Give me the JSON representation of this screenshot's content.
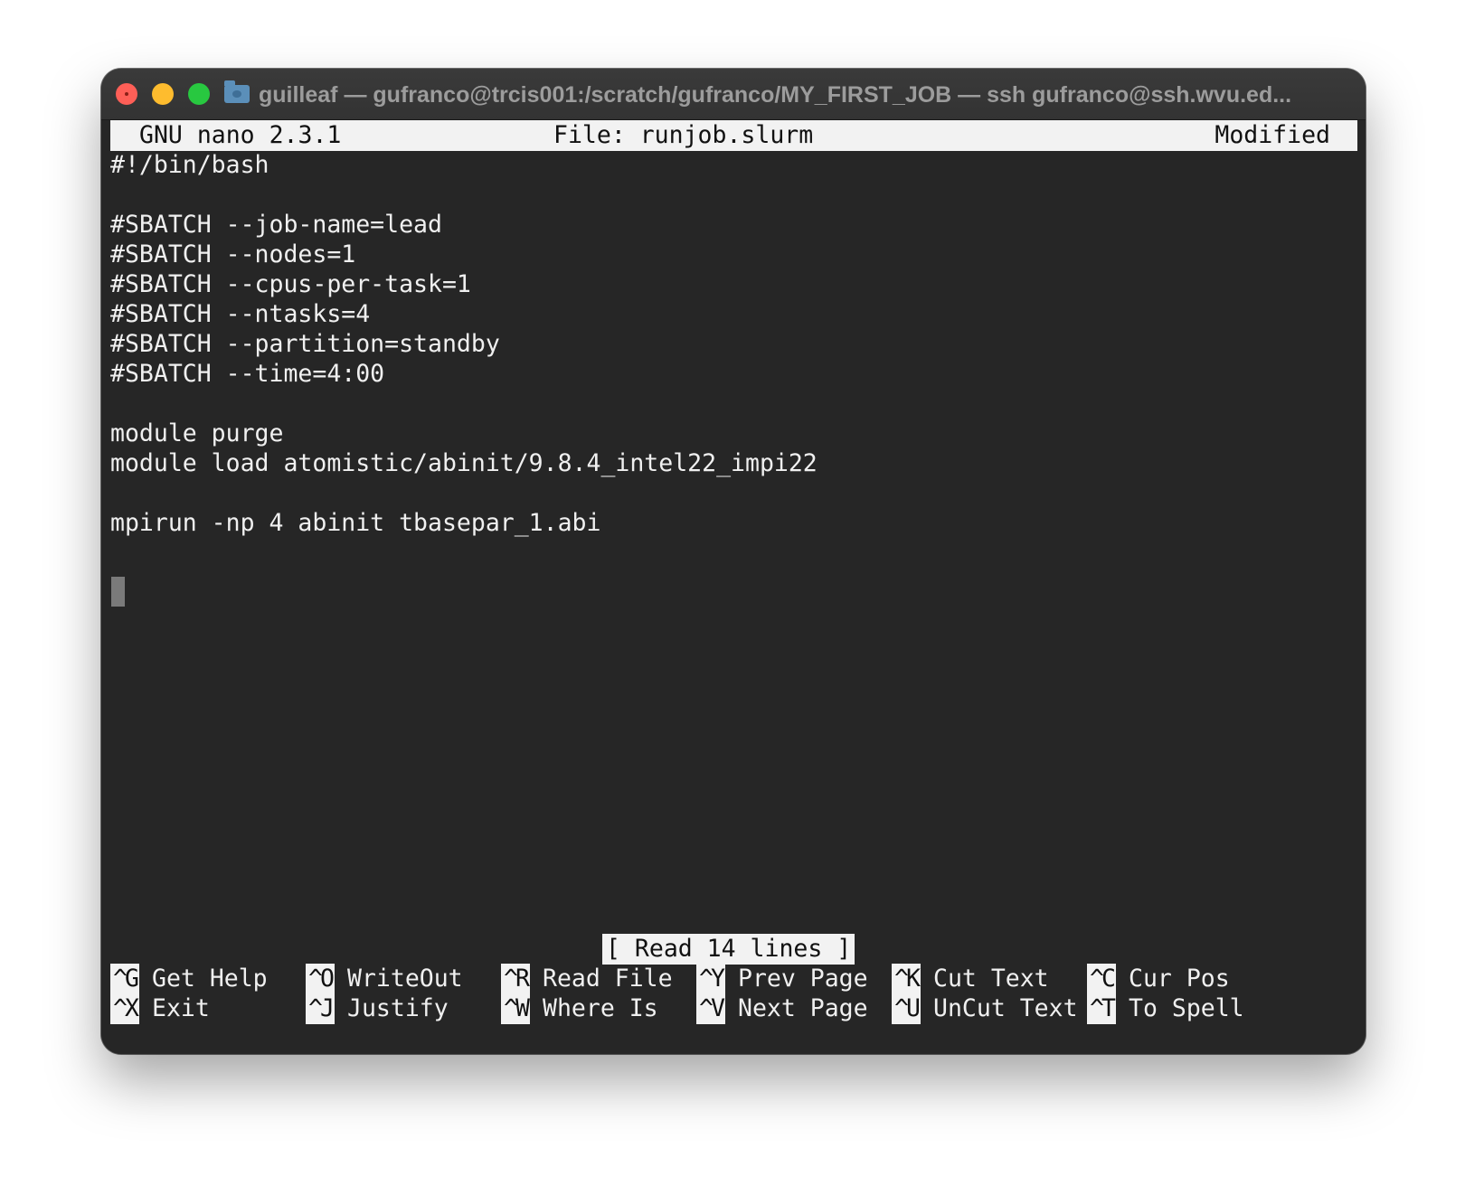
{
  "window": {
    "title": "guilleaf — gufranco@trcis001:/scratch/gufranco/MY_FIRST_JOB — ssh gufranco@ssh.wvu.ed..."
  },
  "nano": {
    "app_version": "GNU nano 2.3.1",
    "file_label": "File: runjob.slurm",
    "state": "Modified"
  },
  "editor": {
    "lines": [
      "#!/bin/bash",
      "",
      "#SBATCH --job-name=lead",
      "#SBATCH --nodes=1",
      "#SBATCH --cpus-per-task=1",
      "#SBATCH --ntasks=4",
      "#SBATCH --partition=standby",
      "#SBATCH --time=4:00",
      "",
      "module purge",
      "module load atomistic/abinit/9.8.4_intel22_impi22",
      "",
      "mpirun -np 4 abinit tbasepar_1.abi"
    ]
  },
  "status_message": "[ Read 14 lines ]",
  "shortcuts": {
    "row1": [
      {
        "key": "^G",
        "label": "Get Help"
      },
      {
        "key": "^O",
        "label": "WriteOut"
      },
      {
        "key": "^R",
        "label": "Read File"
      },
      {
        "key": "^Y",
        "label": "Prev Page"
      },
      {
        "key": "^K",
        "label": "Cut Text"
      },
      {
        "key": "^C",
        "label": "Cur Pos"
      }
    ],
    "row2": [
      {
        "key": "^X",
        "label": "Exit"
      },
      {
        "key": "^J",
        "label": "Justify"
      },
      {
        "key": "^W",
        "label": "Where Is"
      },
      {
        "key": "^V",
        "label": "Next Page"
      },
      {
        "key": "^U",
        "label": "UnCut Text"
      },
      {
        "key": "^T",
        "label": "To Spell"
      }
    ]
  },
  "colors": {
    "terminal_bg": "#262626",
    "text": "#f0f0f0",
    "inverse_bg": "#f2f2f2",
    "close": "#fe5f57",
    "minimize": "#febc2e",
    "maximize": "#28c840"
  }
}
